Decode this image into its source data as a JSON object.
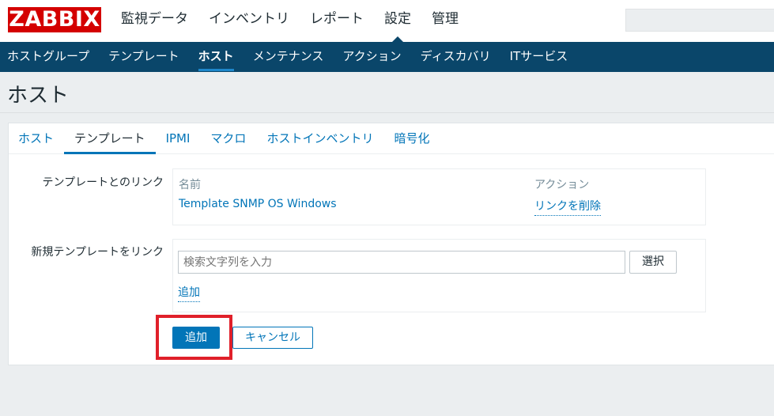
{
  "header": {
    "logo": "ZABBIX",
    "menu": [
      "監視データ",
      "インベントリ",
      "レポート",
      "設定",
      "管理"
    ],
    "active_menu": 3,
    "search_placeholder": ""
  },
  "subnav": {
    "items": [
      "ホストグループ",
      "テンプレート",
      "ホスト",
      "メンテナンス",
      "アクション",
      "ディスカバリ",
      "ITサービス"
    ],
    "active": 2
  },
  "page": {
    "title": "ホスト"
  },
  "tabs": {
    "items": [
      "ホスト",
      "テンプレート",
      "IPMI",
      "マクロ",
      "ホストインベントリ",
      "暗号化"
    ],
    "active": 1
  },
  "linked_templates": {
    "label": "テンプレートとのリンク",
    "col_name": "名前",
    "col_action": "アクション",
    "rows": [
      {
        "name": "Template SNMP OS Windows",
        "action": "リンクを削除"
      }
    ]
  },
  "new_template": {
    "label": "新規テンプレートをリンク",
    "search_placeholder": "検索文字列を入力",
    "select_label": "選択",
    "add_link": "追加"
  },
  "form_buttons": {
    "add": "追加",
    "cancel": "キャンセル"
  },
  "colors": {
    "brand": "#d40000",
    "nav_bg": "#0a466a",
    "accent": "#0275b8",
    "highlight": "#e0202a"
  }
}
